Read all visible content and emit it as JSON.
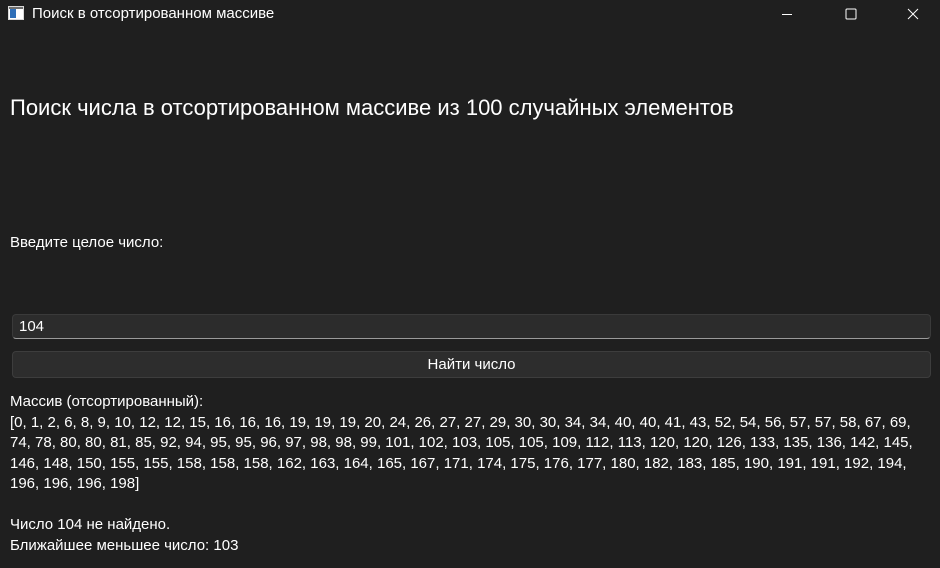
{
  "window": {
    "title": "Поиск в отсортированном массиве",
    "icon": "app-window-icon",
    "controls": {
      "minimize_icon": "minimize-icon",
      "maximize_icon": "maximize-icon",
      "close_icon": "close-icon"
    }
  },
  "main": {
    "heading": "Поиск числа в отсортированном массиве из 100 случайных элементов",
    "prompt_label": "Введите целое число:",
    "input_value": "104",
    "find_button_label": "Найти число",
    "result": {
      "array_label": "Массив (отсортированный):",
      "array_values": "[0, 1, 2, 6, 8, 9, 10, 12, 12, 15, 16, 16, 16, 19, 19, 19, 20, 24, 26, 27, 27, 29, 30, 30, 34, 34, 40, 40, 41, 43, 52, 54, 56, 57, 57, 58, 67, 69, 74, 78, 80, 80, 81, 85, 92, 94, 95, 95, 96, 97, 98, 98, 99, 101, 102, 103, 105, 105, 109, 112, 113, 120, 120, 126, 133, 135, 136, 142, 145, 146, 148, 150, 155, 155, 158, 158, 158, 162, 163, 164, 165, 167, 171, 174, 175, 176, 177, 180, 182, 183, 185, 190, 191, 191, 192, 194, 196, 196, 196, 198]",
      "not_found_message": "Число 104 не найдено.",
      "nearest_lower": "Ближайшее меньшее число: 103"
    }
  },
  "colors": {
    "background": "#1f1f1f",
    "text": "#ffffff",
    "input_background": "#2c2c2c",
    "button_background": "#2d2d2d"
  }
}
